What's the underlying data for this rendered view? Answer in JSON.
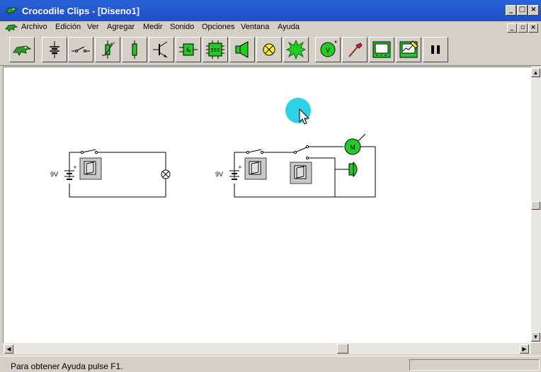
{
  "window": {
    "title": "Crocodile Clips - [Diseno1]"
  },
  "menu": [
    "Archivo",
    "Edición",
    "Ver",
    "Agregar",
    "Medir",
    "Sonido",
    "Opciones",
    "Ventana",
    "Ayuda"
  ],
  "circuit": {
    "battery_left": "9V",
    "battery_right": "9V",
    "motor": "M"
  },
  "toolbar": {
    "chip_555": "555",
    "voltmeter": "V",
    "logic_gate": "&"
  },
  "status": {
    "text": "Para obtener Ayuda pulse F1."
  },
  "colors": {
    "title": "#1b4fc4",
    "component_green": "#22cc22",
    "cursor_highlight": "#2fd0e8"
  }
}
